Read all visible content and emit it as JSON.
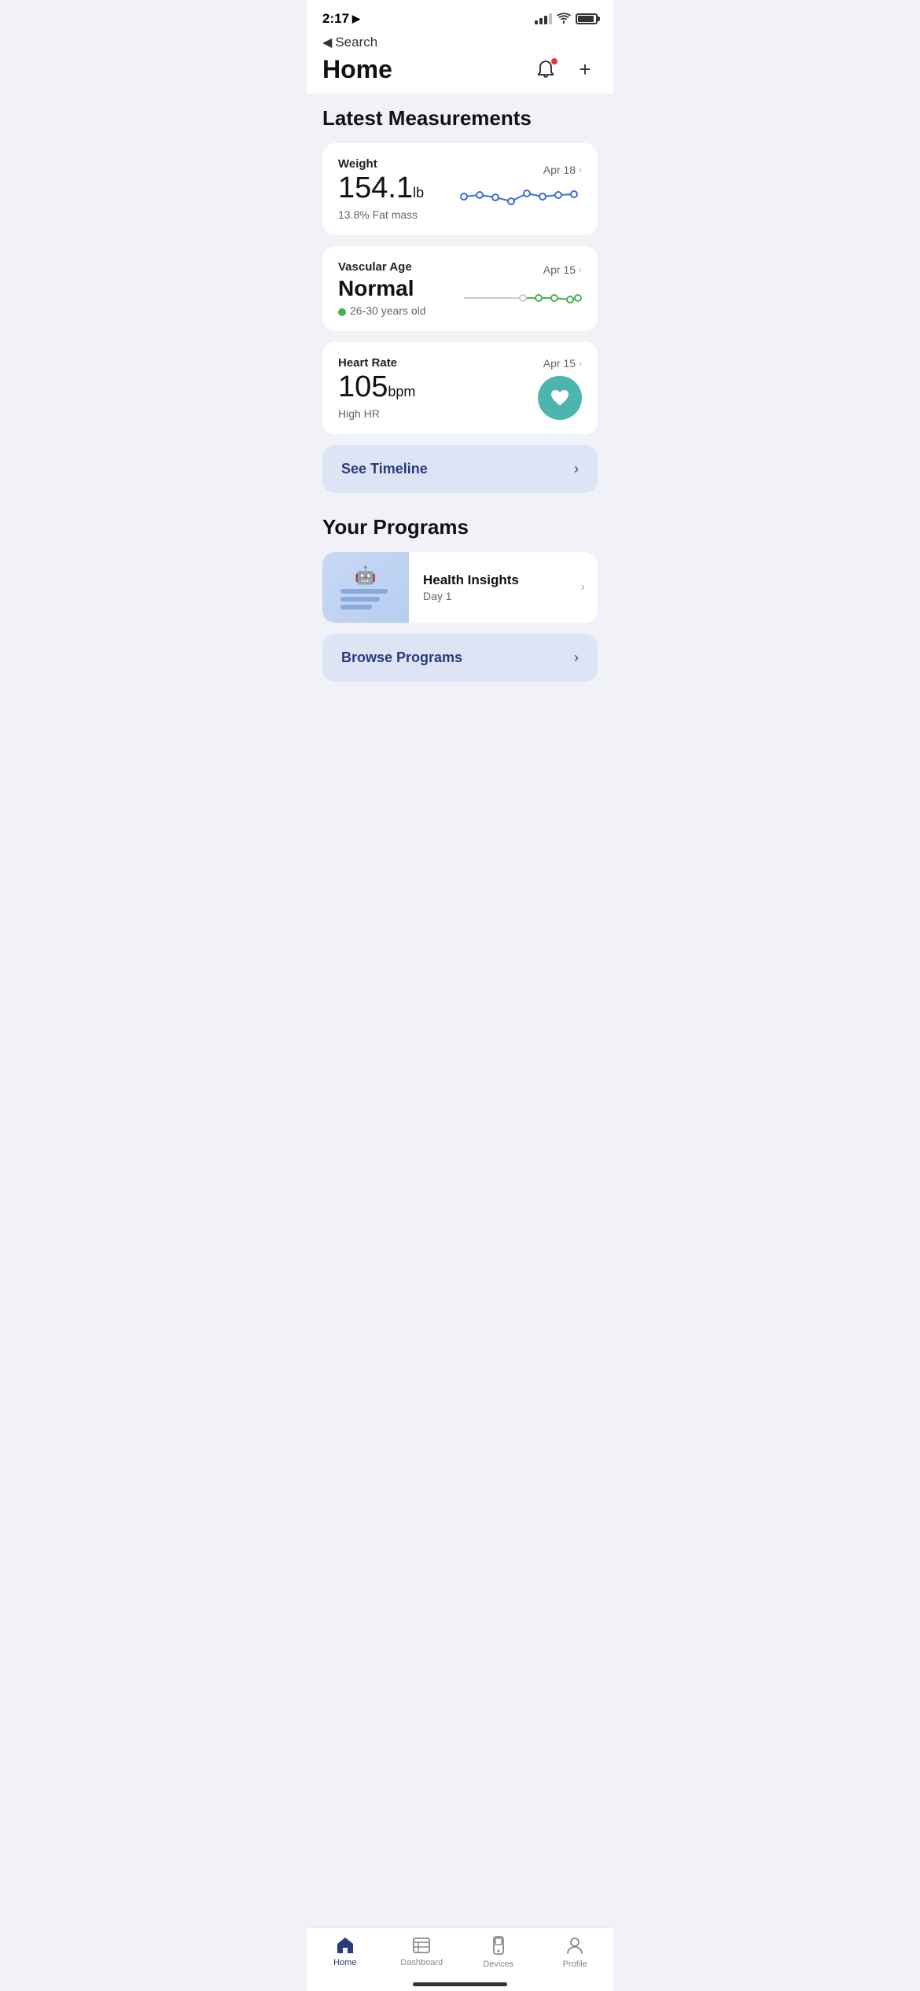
{
  "statusBar": {
    "time": "2:17",
    "locationIcon": "▶",
    "batteryLevel": 85
  },
  "nav": {
    "backLabel": "Search",
    "title": "Home",
    "notificationDot": true
  },
  "latestMeasurements": {
    "sectionTitle": "Latest Measurements",
    "cards": [
      {
        "label": "Weight",
        "value": "154.1",
        "unit": "lb",
        "sub": "13.8% Fat mass",
        "date": "Apr 18",
        "chartType": "line-blue"
      },
      {
        "label": "Vascular Age",
        "valueText": "Normal",
        "sub": "26-30 years old",
        "hasDot": true,
        "date": "Apr 15",
        "chartType": "line-green"
      },
      {
        "label": "Heart Rate",
        "value": "105",
        "unit": "bpm",
        "sub": "High HR",
        "date": "Apr 15",
        "chartType": "heart-icon"
      }
    ]
  },
  "timeline": {
    "buttonLabel": "See Timeline",
    "chevron": "›"
  },
  "programs": {
    "sectionTitle": "Your Programs",
    "items": [
      {
        "name": "Health Insights",
        "day": "Day 1"
      }
    ],
    "browseLabel": "Browse Programs",
    "browseChevron": "›"
  },
  "tabBar": {
    "items": [
      {
        "label": "Home",
        "icon": "house",
        "active": true
      },
      {
        "label": "Dashboard",
        "icon": "dashboard",
        "active": false
      },
      {
        "label": "Devices",
        "icon": "devices",
        "active": false
      },
      {
        "label": "Profile",
        "icon": "profile",
        "active": false
      }
    ]
  }
}
